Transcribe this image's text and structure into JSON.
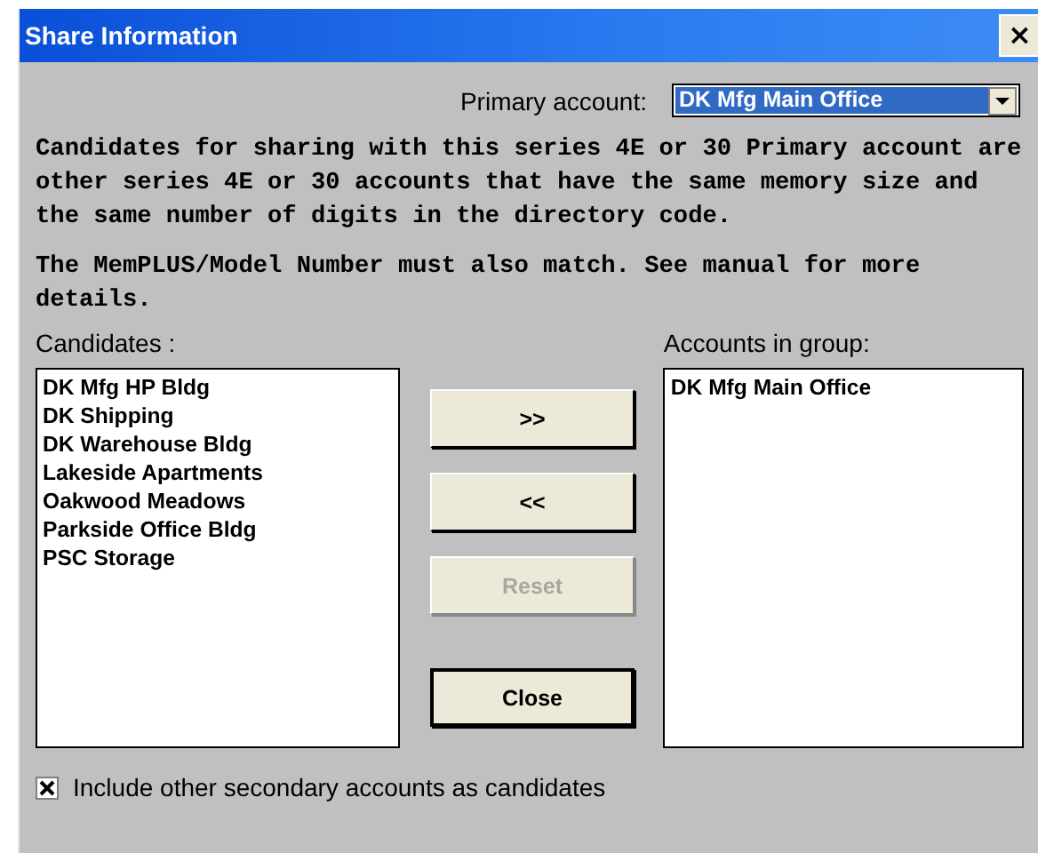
{
  "window": {
    "title": "Share Information",
    "close_glyph": "×"
  },
  "primary_account": {
    "label": "Primary account:",
    "value": "DK Mfg Main Office"
  },
  "description": [
    "Candidates for sharing with this series 4E or 30 Primary account are other series 4E or 30 accounts that have the same memory size and the same number of digits in the directory code.",
    "The MemPLUS/Model Number must also match. See manual for more details."
  ],
  "candidates": {
    "label": "Candidates :",
    "items": [
      "DK Mfg HP Bldg",
      "DK Shipping",
      "DK Warehouse Bldg",
      "Lakeside Apartments",
      "Oakwood Meadows",
      "Parkside Office Bldg",
      "PSC Storage"
    ]
  },
  "group": {
    "label": "Accounts in group:",
    "items": [
      "DK Mfg Main Office"
    ]
  },
  "buttons": [
    {
      "label": ">>",
      "disabled": false,
      "default": false
    },
    {
      "label": "<<",
      "disabled": false,
      "default": false
    },
    {
      "label": "Reset",
      "disabled": true,
      "default": false
    },
    {
      "label": "Close",
      "disabled": false,
      "default": true
    }
  ],
  "include_secondary": {
    "label": "Include other secondary accounts as candidates",
    "checked": true
  }
}
